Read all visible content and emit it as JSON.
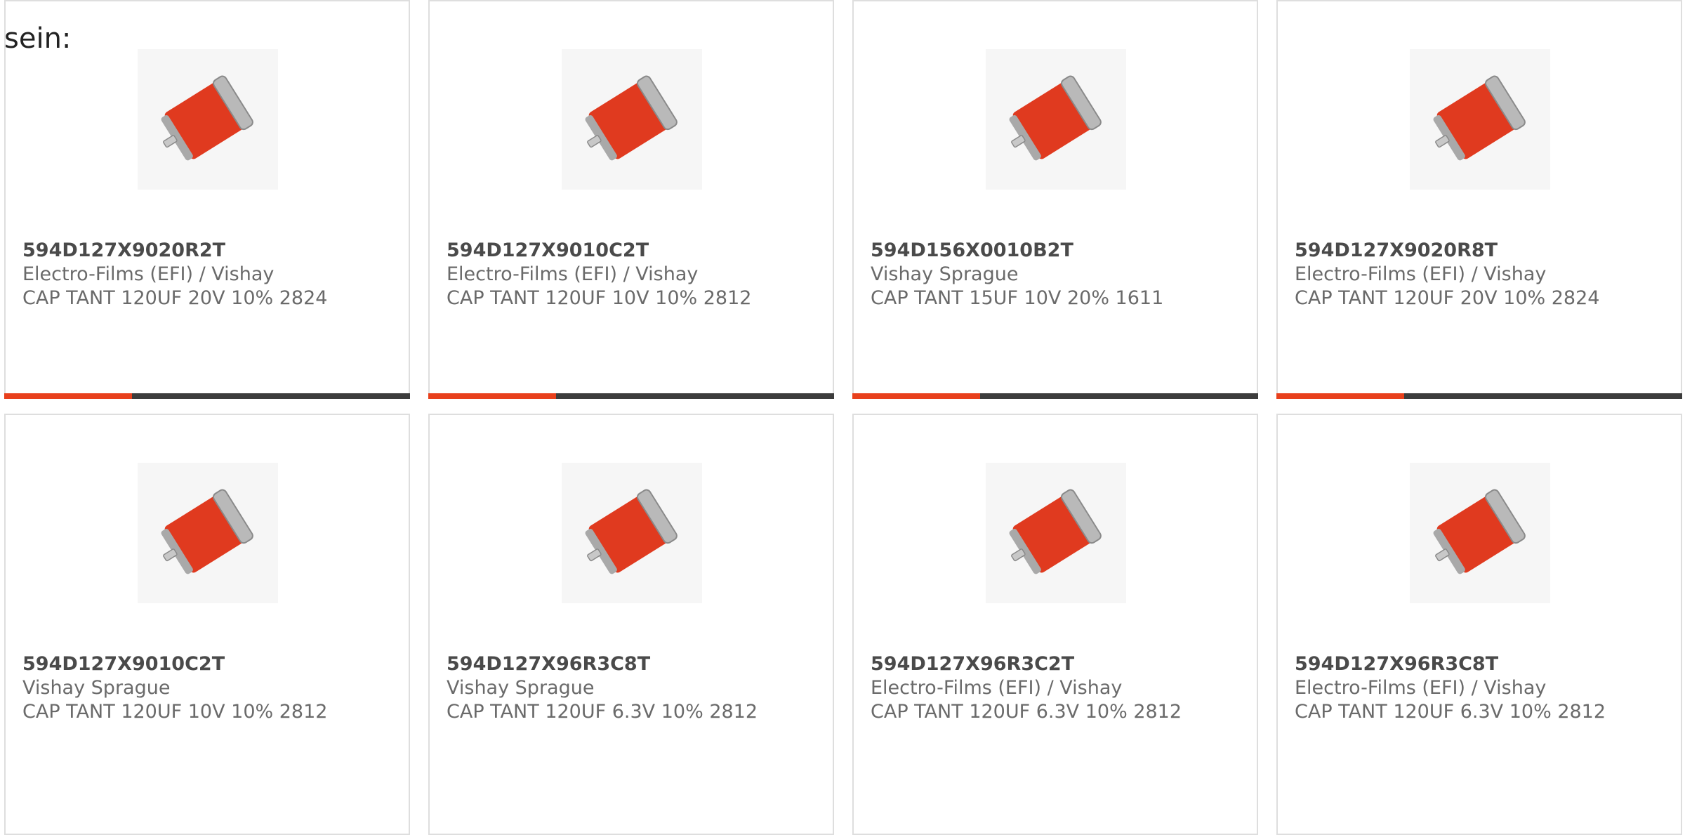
{
  "intro_text": "sein:",
  "colors": {
    "accent": "#e8401c",
    "bar_dark": "#3c3c3c",
    "capacitor_body": "#e03a1f",
    "capacitor_terminal": "#b9b9b9",
    "card_border": "#dedede"
  },
  "products": [
    {
      "part_number": "594D127X9020R2T",
      "manufacturer": "Electro-Films (EFI) / Vishay",
      "description": "CAP TANT 120UF 20V 10% 2824",
      "image_icon": "tantalum-capacitor-icon"
    },
    {
      "part_number": "594D127X9010C2T",
      "manufacturer": "Electro-Films (EFI) / Vishay",
      "description": "CAP TANT 120UF 10V 10% 2812",
      "image_icon": "tantalum-capacitor-icon"
    },
    {
      "part_number": "594D156X0010B2T",
      "manufacturer": "Vishay Sprague",
      "description": "CAP TANT 15UF 10V 20% 1611",
      "image_icon": "tantalum-capacitor-icon"
    },
    {
      "part_number": "594D127X9020R8T",
      "manufacturer": "Electro-Films (EFI) / Vishay",
      "description": "CAP TANT 120UF 20V 10% 2824",
      "image_icon": "tantalum-capacitor-icon"
    },
    {
      "part_number": "594D127X9010C2T",
      "manufacturer": "Vishay Sprague",
      "description": "CAP TANT 120UF 10V 10% 2812",
      "image_icon": "tantalum-capacitor-icon"
    },
    {
      "part_number": "594D127X96R3C8T",
      "manufacturer": "Vishay Sprague",
      "description": "CAP TANT 120UF 6.3V 10% 2812",
      "image_icon": "tantalum-capacitor-icon"
    },
    {
      "part_number": "594D127X96R3C2T",
      "manufacturer": "Electro-Films (EFI) / Vishay",
      "description": "CAP TANT 120UF 6.3V 10% 2812",
      "image_icon": "tantalum-capacitor-icon"
    },
    {
      "part_number": "594D127X96R3C8T",
      "manufacturer": "Electro-Films (EFI) / Vishay",
      "description": "CAP TANT 120UF 6.3V 10% 2812",
      "image_icon": "tantalum-capacitor-icon"
    }
  ]
}
